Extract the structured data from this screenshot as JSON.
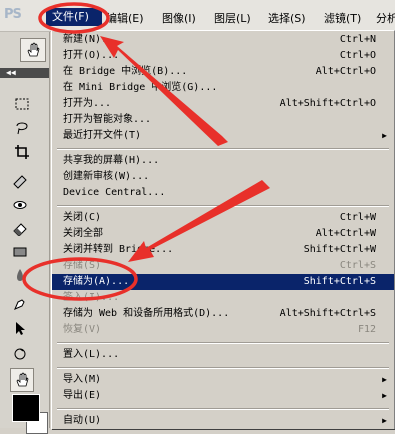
{
  "app": {
    "logo_text": "PS"
  },
  "menubar": {
    "items": [
      {
        "label": "文件(F)"
      },
      {
        "label": "编辑(E)"
      },
      {
        "label": "图像(I)"
      },
      {
        "label": "图层(L)"
      },
      {
        "label": "选择(S)"
      },
      {
        "label": "滤镜(T)"
      },
      {
        "label": "分析"
      }
    ]
  },
  "menu": {
    "rows": [
      {
        "label": "新建(N)...",
        "shortcut": "Ctrl+N"
      },
      {
        "label": "打开(O)...",
        "shortcut": "Ctrl+O"
      },
      {
        "label": "在 Bridge 中浏览(B)...",
        "shortcut": "Alt+Ctrl+O"
      },
      {
        "label": "在 Mini Bridge 中浏览(G)...",
        "shortcut": ""
      },
      {
        "label": "打开为...",
        "shortcut": "Alt+Shift+Ctrl+O"
      },
      {
        "label": "打开为智能对象...",
        "shortcut": ""
      },
      {
        "label": "最近打开文件(T)",
        "shortcut": ""
      },
      {
        "label": "共享我的屏幕(H)...",
        "shortcut": ""
      },
      {
        "label": "创建新审核(W)...",
        "shortcut": ""
      },
      {
        "label": "Device Central...",
        "shortcut": ""
      },
      {
        "label": "关闭(C)",
        "shortcut": "Ctrl+W"
      },
      {
        "label": "关闭全部",
        "shortcut": "Alt+Ctrl+W"
      },
      {
        "label": "关闭并转到 Bridge...",
        "shortcut": "Shift+Ctrl+W"
      },
      {
        "label": "存储(S)",
        "shortcut": "Ctrl+S"
      },
      {
        "label": "存储为(A)...",
        "shortcut": "Shift+Ctrl+S"
      },
      {
        "label": "签入(I)...",
        "shortcut": ""
      },
      {
        "label": "存储为 Web 和设备所用格式(D)...",
        "shortcut": "Alt+Shift+Ctrl+S"
      },
      {
        "label": "恢复(V)",
        "shortcut": "F12"
      },
      {
        "label": "置入(L)...",
        "shortcut": ""
      },
      {
        "label": "导入(M)",
        "shortcut": ""
      },
      {
        "label": "导出(E)",
        "shortcut": ""
      },
      {
        "label": "自动(U)",
        "shortcut": ""
      }
    ],
    "submenu_arrow": "▶"
  },
  "colors": {
    "highlight": "#0a246a",
    "annotation": "#e8302a"
  }
}
